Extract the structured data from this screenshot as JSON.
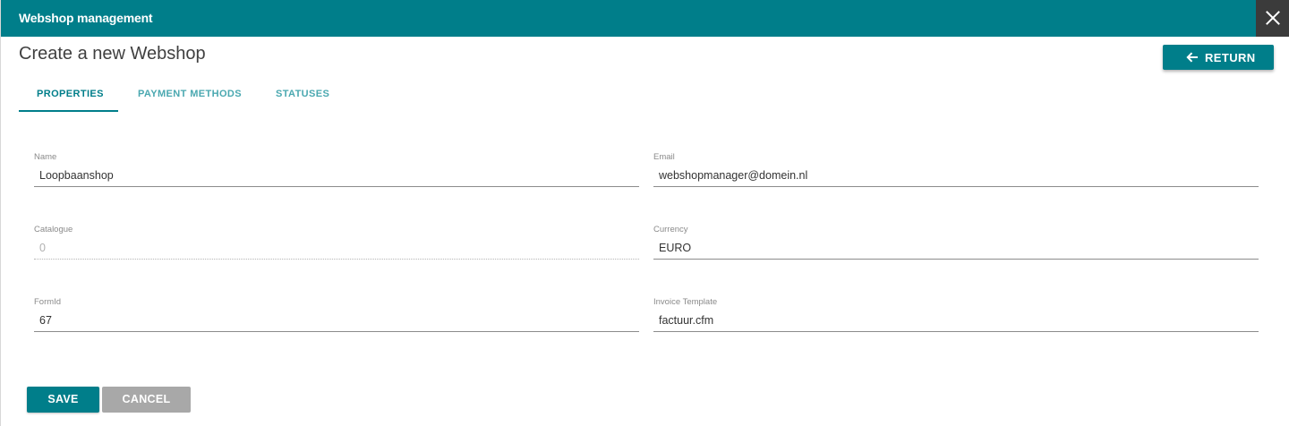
{
  "window": {
    "title": "Webshop management"
  },
  "page": {
    "title": "Create a new Webshop"
  },
  "header": {
    "return_label": "RETURN"
  },
  "tabs": [
    {
      "label": "PROPERTIES",
      "active": true
    },
    {
      "label": "PAYMENT METHODS",
      "active": false
    },
    {
      "label": "STATUSES",
      "active": false
    }
  ],
  "form": {
    "name": {
      "label": "Name",
      "value": "Loopbaanshop"
    },
    "email": {
      "label": "Email",
      "value": "webshopmanager@domein.nl"
    },
    "catalogue": {
      "label": "Catalogue",
      "value": "0",
      "disabled": true
    },
    "currency": {
      "label": "Currency",
      "value": "EURO"
    },
    "formid": {
      "label": "FormId",
      "value": "67"
    },
    "invoice_template": {
      "label": "Invoice Template",
      "value": "factuur.cfm"
    }
  },
  "actions": {
    "save_label": "SAVE",
    "cancel_label": "CANCEL"
  },
  "icons": {
    "close": "close-icon",
    "return": "arrow-left-icon"
  },
  "colors": {
    "accent": "#007e8a",
    "tab_inactive": "#4aa8b0",
    "cancel": "#a8a8a8",
    "close_bg": "#3b3b3b"
  }
}
